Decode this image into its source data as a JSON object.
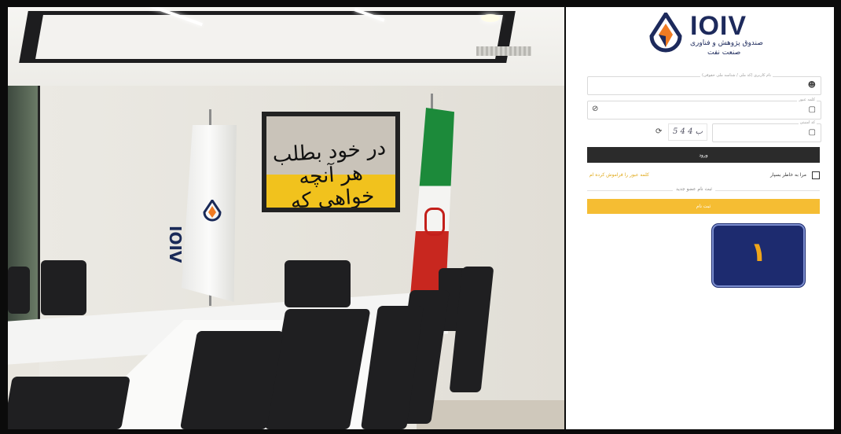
{
  "photo": {
    "painting_text": "در خود بطلب هر آنچه خواهی که تویی",
    "flag_text": "IOIV"
  },
  "brand": {
    "name": "IOIV",
    "subtitle_line1": "صندوق پژوهش و فناوری",
    "subtitle_line2": "صنعت نفت",
    "navy": "#1d2a5c",
    "accent": "#f5bd33"
  },
  "form": {
    "username": {
      "label": "نام کاربری (کد ملی / شناسه ملی حقوقی)",
      "value": "",
      "icon": "user-icon"
    },
    "password": {
      "label": "کلمه عبور",
      "value": "",
      "icon": "lock-icon",
      "toggle_icon": "eye-slash-icon"
    },
    "captcha": {
      "label": "کد امنیتی",
      "value": "",
      "image_text": "5 4 ب 4",
      "refresh_icon": "refresh-icon",
      "icon": "lock-icon"
    },
    "login_button": "ورود",
    "remember_me": "مرا به خاطر بسپار",
    "forgot_password": "کلمه عبور را فراموش کرده ام",
    "divider_text": "ثبت نام عضو جدید",
    "register_button": "ثبت نام"
  },
  "annotation": {
    "number": "١"
  }
}
